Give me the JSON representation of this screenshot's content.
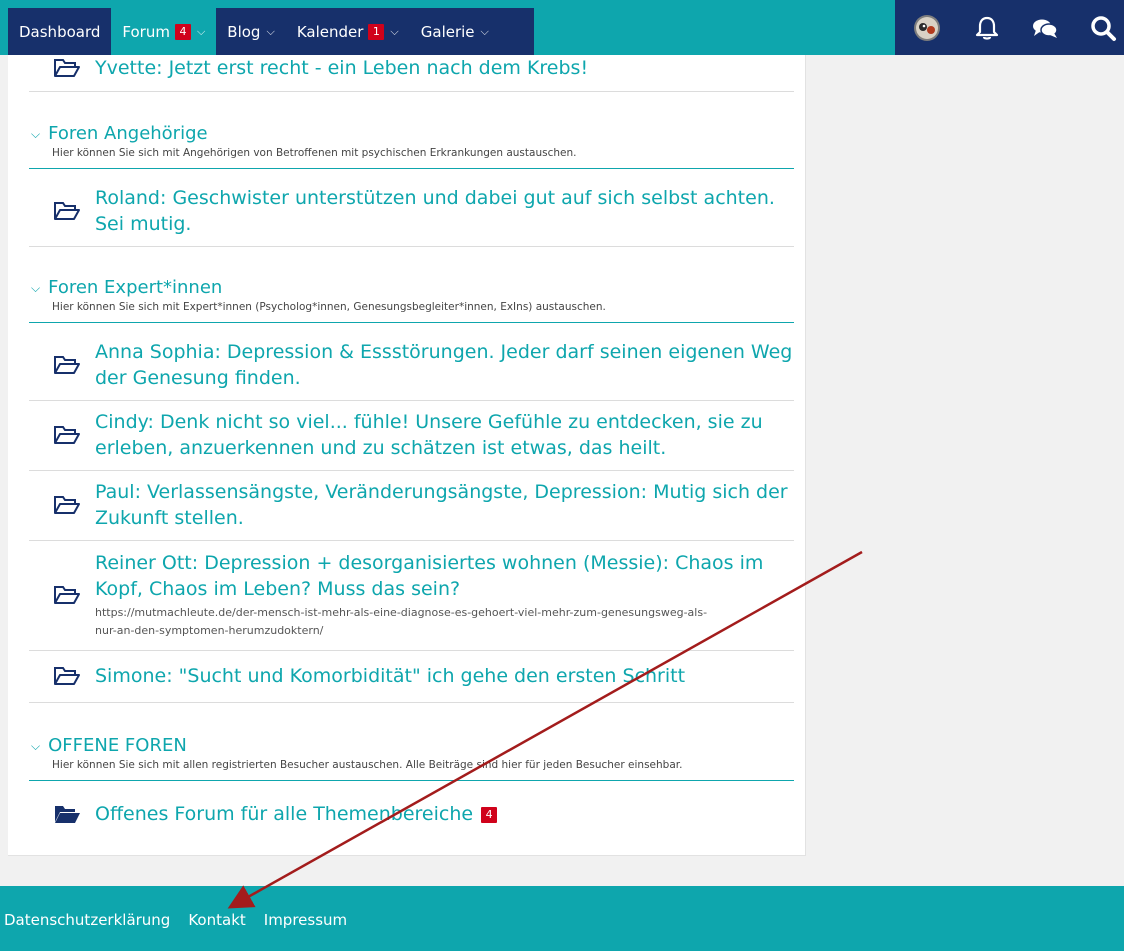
{
  "nav": {
    "items": [
      {
        "label": "Dashboard",
        "badge": "",
        "dropdown": false,
        "active": false
      },
      {
        "label": "Forum",
        "badge": "4",
        "dropdown": true,
        "active": true
      },
      {
        "label": "Blog",
        "badge": "",
        "dropdown": true,
        "active": false
      },
      {
        "label": "Kalender",
        "badge": "1",
        "dropdown": true,
        "active": false
      },
      {
        "label": "Galerie",
        "badge": "",
        "dropdown": true,
        "active": false
      }
    ],
    "right_icons": [
      "avatar",
      "bell-icon",
      "chat-icon",
      "search-icon"
    ]
  },
  "forum": {
    "top_board": "Yvette: Jetzt erst recht - ein Leben nach dem Krebs!",
    "categories": [
      {
        "title": "Foren Angehörige",
        "description": "Hier können Sie sich mit Angehörigen von Betroffenen mit psychischen Erkrankungen austauschen.",
        "boards": [
          {
            "title_l1": "Roland: Geschwister unterstützen und dabei gut auf sich selbst achten.",
            "title_l2": "Sei mutig."
          }
        ]
      },
      {
        "title": "Foren Expert*innen",
        "description": "Hier können Sie sich mit Expert*innen (Psycholog*innen, Genesungsbegleiter*innen, ExIns) austauschen.",
        "boards": [
          {
            "title_l1": "Anna Sophia: Depression & Essstörungen. Jeder darf seinen eigenen Weg",
            "title_l2": "der Genesung finden."
          },
          {
            "title_l1": "Cindy: Denk nicht so viel... fühle! Unsere Gefühle zu entdecken, sie zu",
            "title_l2": "erleben, anzuerkennen und zu schätzen ist etwas, das heilt."
          },
          {
            "title_l1": "Paul: Verlassensängste, Veränderungsängste, Depression: Mutig sich der",
            "title_l2": "Zukunft stellen."
          },
          {
            "title_l1": "Reiner Ott: Depression + desorganisiertes wohnen (Messie): Chaos im",
            "title_l2": "Kopf, Chaos im Leben? Muss das sein?",
            "url_l1": "https://mutmachleute.de/der-mensch-ist-mehr-als-eine-diagnose-es-gehoert-viel-mehr-zum-genesungsweg-als-",
            "url_l2": "nur-an-den-symptomen-herumzudoktern/"
          },
          {
            "title_l1": "Simone: \"Sucht und Komorbidität\" ich gehe den ersten Schritt"
          }
        ]
      },
      {
        "title": "OFFENE FOREN",
        "description": "Hier können Sie sich mit allen registrierten Besucher austauschen. Alle Beiträge sind hier für jeden Besucher einsehbar.",
        "boards": [
          {
            "title_l1": "Offenes Forum für alle Themenbereiche",
            "badge": "4"
          }
        ]
      }
    ]
  },
  "footer": {
    "links": [
      "Datenschutzerklärung",
      "Kontakt",
      "Impressum"
    ]
  },
  "colors": {
    "teal": "#0ea6ad",
    "navy": "#17306b",
    "badge_red": "#d0021b",
    "arrow": "#a31c1c"
  }
}
